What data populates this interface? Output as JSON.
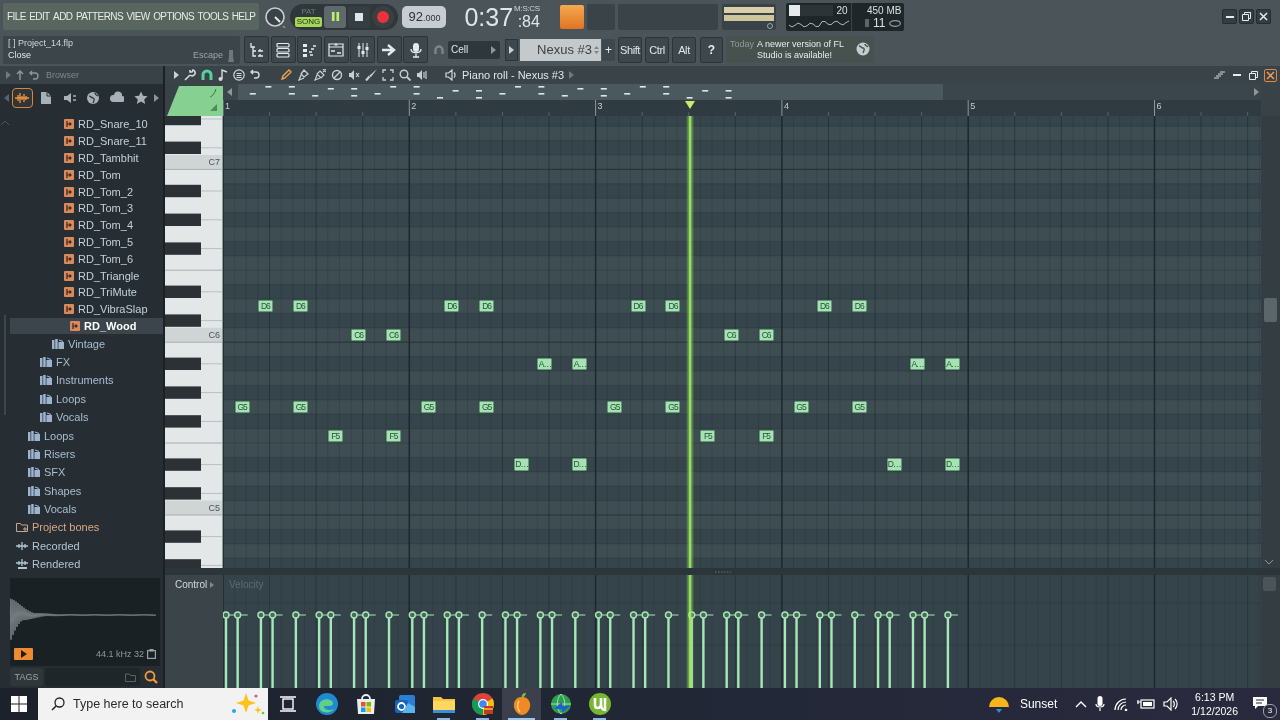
{
  "menu": [
    "FILE",
    "EDIT",
    "ADD",
    "PATTERNS",
    "VIEW",
    "OPTIONS",
    "TOOLS",
    "HELP"
  ],
  "transport": {
    "modes": [
      {
        "label": "PAT",
        "selected": false
      },
      {
        "label": "SONG",
        "selected": true
      }
    ],
    "playing": true,
    "tempo": "92",
    "tempo_fraction": ".000"
  },
  "clock": {
    "time": "0:37",
    "centiseconds": ":84",
    "unit": "M:S:CS"
  },
  "top_toggle": {
    "on": true
  },
  "monitor": {
    "cpu": {
      "reading": "20",
      "level": 0.25
    },
    "memory": "450 MB",
    "polyphony": "11"
  },
  "hint": {
    "title": "[ ] Project_14.flp",
    "action": "Close",
    "shortcut": "Escape"
  },
  "toolbar": {
    "snap": "Cell",
    "pattern": "Nexus #3",
    "add": "+",
    "modifiers": [
      "Shift",
      "Ctrl",
      "Alt"
    ],
    "help": "?"
  },
  "news": {
    "date": "Today",
    "message": "A newer version of FL Studio is available!"
  },
  "browser": {
    "title": "Browser",
    "tabs": [
      {
        "selected": true
      },
      {
        "selected": false
      },
      {
        "selected": false
      },
      {
        "selected": false
      },
      {
        "selected": false
      },
      {
        "selected": false
      }
    ],
    "tree": [
      {
        "children": [
          {
            "children": [
              {
                "children": [
                  {
                    "children": [
                      {
                        "label": "RD_Snare_10",
                        "kind": "sample",
                        "selected": false
                      },
                      {
                        "label": "RD_Snare_11",
                        "kind": "sample",
                        "selected": false
                      },
                      {
                        "label": "RD_Tambhit",
                        "kind": "sample",
                        "selected": false
                      },
                      {
                        "label": "RD_Tom",
                        "kind": "sample",
                        "selected": false
                      },
                      {
                        "label": "RD_Tom_2",
                        "kind": "sample",
                        "selected": false
                      },
                      {
                        "label": "RD_Tom_3",
                        "kind": "sample",
                        "selected": false
                      },
                      {
                        "label": "RD_Tom_4",
                        "kind": "sample",
                        "selected": false
                      },
                      {
                        "label": "RD_Tom_5",
                        "kind": "sample",
                        "selected": false
                      },
                      {
                        "label": "RD_Tom_6",
                        "kind": "sample",
                        "selected": false
                      },
                      {
                        "label": "RD_Triangle",
                        "kind": "sample",
                        "selected": false
                      },
                      {
                        "label": "RD_TriMute",
                        "kind": "sample",
                        "selected": false
                      },
                      {
                        "label": "RD_VibraSlap",
                        "kind": "sample",
                        "selected": false
                      },
                      {
                        "label": "RD_Wood",
                        "kind": "sample",
                        "selected": true
                      }
                    ]
                  },
                  {
                    "label": "Vintage",
                    "kind": "folder",
                    "selected": false
                  }
                ]
              },
              {
                "label": "FX",
                "kind": "folder",
                "selected": false
              },
              {
                "label": "Instruments",
                "kind": "folder",
                "selected": false
              },
              {
                "label": "Loops",
                "kind": "folder",
                "selected": false
              },
              {
                "label": "Vocals",
                "kind": "folder",
                "selected": false
              }
            ]
          },
          {
            "label": "Loops",
            "kind": "folder",
            "selected": false
          },
          {
            "label": "Risers",
            "kind": "folder",
            "selected": false
          },
          {
            "label": "SFX",
            "kind": "folder",
            "selected": false
          },
          {
            "label": "Shapes",
            "kind": "folder",
            "selected": false
          },
          {
            "label": "Vocals",
            "kind": "folder",
            "selected": false
          }
        ]
      },
      {
        "label": "Project bones",
        "kind": "project",
        "selected": false
      },
      {
        "label": "Recorded",
        "kind": "recorded",
        "selected": false
      },
      {
        "label": "Rendered",
        "kind": "rendered",
        "selected": false
      }
    ],
    "preview": {
      "info": "44.1 kHz 32"
    },
    "tags": "TAGS"
  },
  "piano_roll": {
    "title": "Piano roll - Nexus #3",
    "snap": {
      "on": true
    },
    "tools": [
      {
        "selected": true
      },
      {
        "selected": false
      },
      {
        "selected": false
      },
      {
        "selected": false
      },
      {
        "selected": false
      },
      {
        "selected": false
      },
      {
        "selected": false
      },
      {
        "selected": false
      },
      {
        "selected": false
      }
    ],
    "ruler": [
      "1",
      "2",
      "3",
      "4",
      "5",
      "6"
    ],
    "key_labels": [
      "C7",
      "C6",
      "C5"
    ],
    "notes": [
      {
        "label": "D6"
      },
      {
        "label": "D6"
      },
      {
        "label": "D6"
      },
      {
        "label": "D6"
      },
      {
        "label": "D6"
      },
      {
        "label": "D6"
      },
      {
        "label": "D6"
      },
      {
        "label": "D6"
      },
      {
        "label": "C6"
      },
      {
        "label": "C6"
      },
      {
        "label": "C6"
      },
      {
        "label": "C6"
      },
      {
        "label": "A…"
      },
      {
        "label": "A…"
      },
      {
        "label": "A…"
      },
      {
        "label": "A…"
      },
      {
        "label": "G5"
      },
      {
        "label": "G5"
      },
      {
        "label": "G5"
      },
      {
        "label": "G5"
      },
      {
        "label": "G5"
      },
      {
        "label": "G5"
      },
      {
        "label": "G5"
      },
      {
        "label": "G5"
      },
      {
        "label": "F5"
      },
      {
        "label": "F5"
      },
      {
        "label": "F5"
      },
      {
        "label": "F5"
      },
      {
        "label": "D…"
      },
      {
        "label": "D…"
      },
      {
        "label": "D…"
      },
      {
        "label": "D…"
      }
    ],
    "control": "Control",
    "lane": "Velocity"
  },
  "taskbar": {
    "search_placeholder": "Type here to search",
    "apps": [
      {
        "running": false,
        "selected": false
      },
      {
        "running": false,
        "selected": false
      },
      {
        "running": false,
        "selected": false
      },
      {
        "running": true,
        "selected": false
      },
      {
        "running": true,
        "selected": false
      },
      {
        "running": true,
        "selected": true
      },
      {
        "running": true,
        "selected": false
      },
      {
        "running": true,
        "selected": false
      }
    ],
    "weather": "Sunset",
    "time": "6:13 PM",
    "date": "1/12/2026",
    "notifications": "3"
  }
}
